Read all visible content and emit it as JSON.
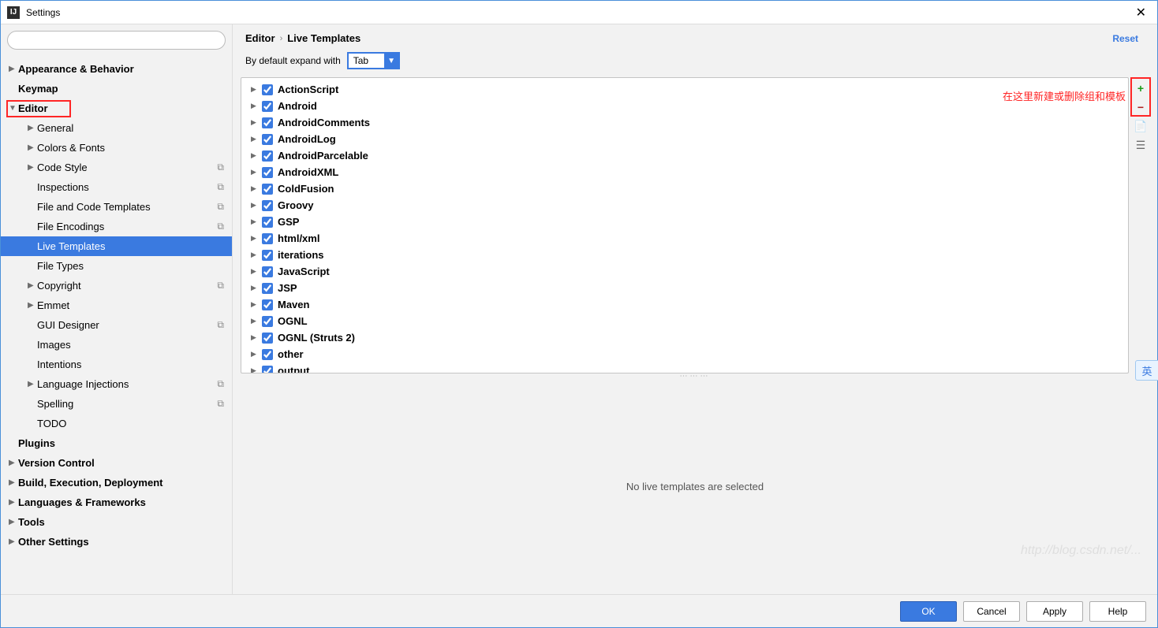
{
  "window": {
    "title": "Settings",
    "close": "✕"
  },
  "search": {
    "placeholder": ""
  },
  "sidebar": {
    "items": [
      {
        "label": "Appearance & Behavior",
        "lvl": 0,
        "arrow": "▶",
        "bold": true
      },
      {
        "label": "Keymap",
        "lvl": 0,
        "arrow": "",
        "bold": true
      },
      {
        "label": "Editor",
        "lvl": 0,
        "arrow": "▼",
        "bold": true,
        "highlight": true
      },
      {
        "label": "General",
        "lvl": 1,
        "arrow": "▶"
      },
      {
        "label": "Colors & Fonts",
        "lvl": 1,
        "arrow": "▶"
      },
      {
        "label": "Code Style",
        "lvl": 1,
        "arrow": "▶",
        "copy": true
      },
      {
        "label": "Inspections",
        "lvl": 1,
        "arrow": "",
        "copy": true
      },
      {
        "label": "File and Code Templates",
        "lvl": 1,
        "arrow": "",
        "copy": true
      },
      {
        "label": "File Encodings",
        "lvl": 1,
        "arrow": "",
        "copy": true
      },
      {
        "label": "Live Templates",
        "lvl": 1,
        "arrow": "",
        "selected": true,
        "highlight": true
      },
      {
        "label": "File Types",
        "lvl": 1,
        "arrow": ""
      },
      {
        "label": "Copyright",
        "lvl": 1,
        "arrow": "▶",
        "copy": true
      },
      {
        "label": "Emmet",
        "lvl": 1,
        "arrow": "▶"
      },
      {
        "label": "GUI Designer",
        "lvl": 1,
        "arrow": "",
        "copy": true
      },
      {
        "label": "Images",
        "lvl": 1,
        "arrow": ""
      },
      {
        "label": "Intentions",
        "lvl": 1,
        "arrow": ""
      },
      {
        "label": "Language Injections",
        "lvl": 1,
        "arrow": "▶",
        "copy": true
      },
      {
        "label": "Spelling",
        "lvl": 1,
        "arrow": "",
        "copy": true
      },
      {
        "label": "TODO",
        "lvl": 1,
        "arrow": ""
      },
      {
        "label": "Plugins",
        "lvl": 0,
        "arrow": "",
        "bold": true
      },
      {
        "label": "Version Control",
        "lvl": 0,
        "arrow": "▶",
        "bold": true
      },
      {
        "label": "Build, Execution, Deployment",
        "lvl": 0,
        "arrow": "▶",
        "bold": true
      },
      {
        "label": "Languages & Frameworks",
        "lvl": 0,
        "arrow": "▶",
        "bold": true
      },
      {
        "label": "Tools",
        "lvl": 0,
        "arrow": "▶",
        "bold": true
      },
      {
        "label": "Other Settings",
        "lvl": 0,
        "arrow": "▶",
        "bold": true
      }
    ]
  },
  "breadcrumb": {
    "root": "Editor",
    "leaf": "Live Templates",
    "reset": "Reset"
  },
  "expand": {
    "label": "By default expand with",
    "value": "Tab"
  },
  "groups": [
    "ActionScript",
    "Android",
    "AndroidComments",
    "AndroidLog",
    "AndroidParcelable",
    "AndroidXML",
    "ColdFusion",
    "Groovy",
    "GSP",
    "html/xml",
    "iterations",
    "JavaScript",
    "JSP",
    "Maven",
    "OGNL",
    "OGNL (Struts 2)",
    "other",
    "output"
  ],
  "annotation": "在这里新建或删除组和模板",
  "empty_msg": "No live templates are selected",
  "footer": {
    "ok": "OK",
    "cancel": "Cancel",
    "apply": "Apply",
    "help": "Help"
  },
  "watermark": "http://blog.csdn.net/...",
  "ime": "英"
}
